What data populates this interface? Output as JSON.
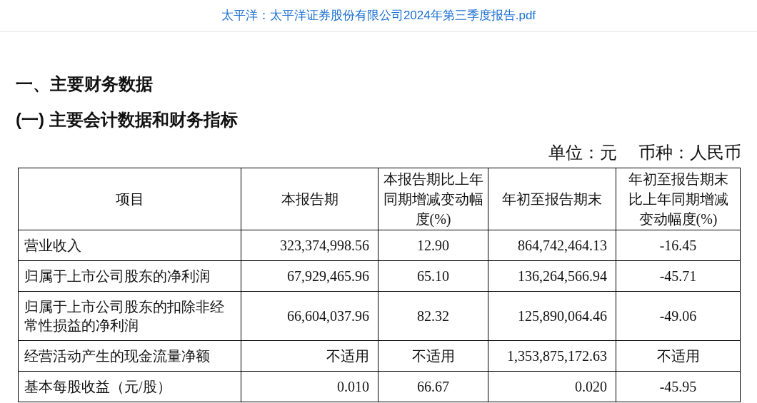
{
  "header": {
    "title": "太平洋：太平洋证券股份有限公司2024年第三季度报告.pdf"
  },
  "headings": [
    "一、主要财务数据",
    "(一) 主要会计数据和财务指标"
  ],
  "unit": {
    "unit": "单位：元",
    "currency": "币种：人民币"
  },
  "table": {
    "columns": [
      "项目",
      "本报告期",
      "本报告期比上年同期增减变动幅度(%)",
      "年初至报告期末",
      "年初至报告期末比上年同期增减变动幅度(%)"
    ],
    "rows": [
      [
        "营业收入",
        "323,374,998.56",
        "12.90",
        "864,742,464.13",
        "-16.45"
      ],
      [
        "归属于上市公司股东的净利润",
        "67,929,465.96",
        "65.10",
        "136,264,566.94",
        "-45.71"
      ],
      [
        "归属于上市公司股东的扣除非经常性损益的净利润",
        "66,604,037.96",
        "82.32",
        "125,890,064.46",
        "-49.06"
      ],
      [
        "经营活动产生的现金流量净额",
        "不适用",
        "不适用",
        "1,353,875,172.63",
        "不适用"
      ],
      [
        "基本每股收益（元/股）",
        "0.010",
        "66.67",
        "0.020",
        "-45.95"
      ]
    ]
  }
}
